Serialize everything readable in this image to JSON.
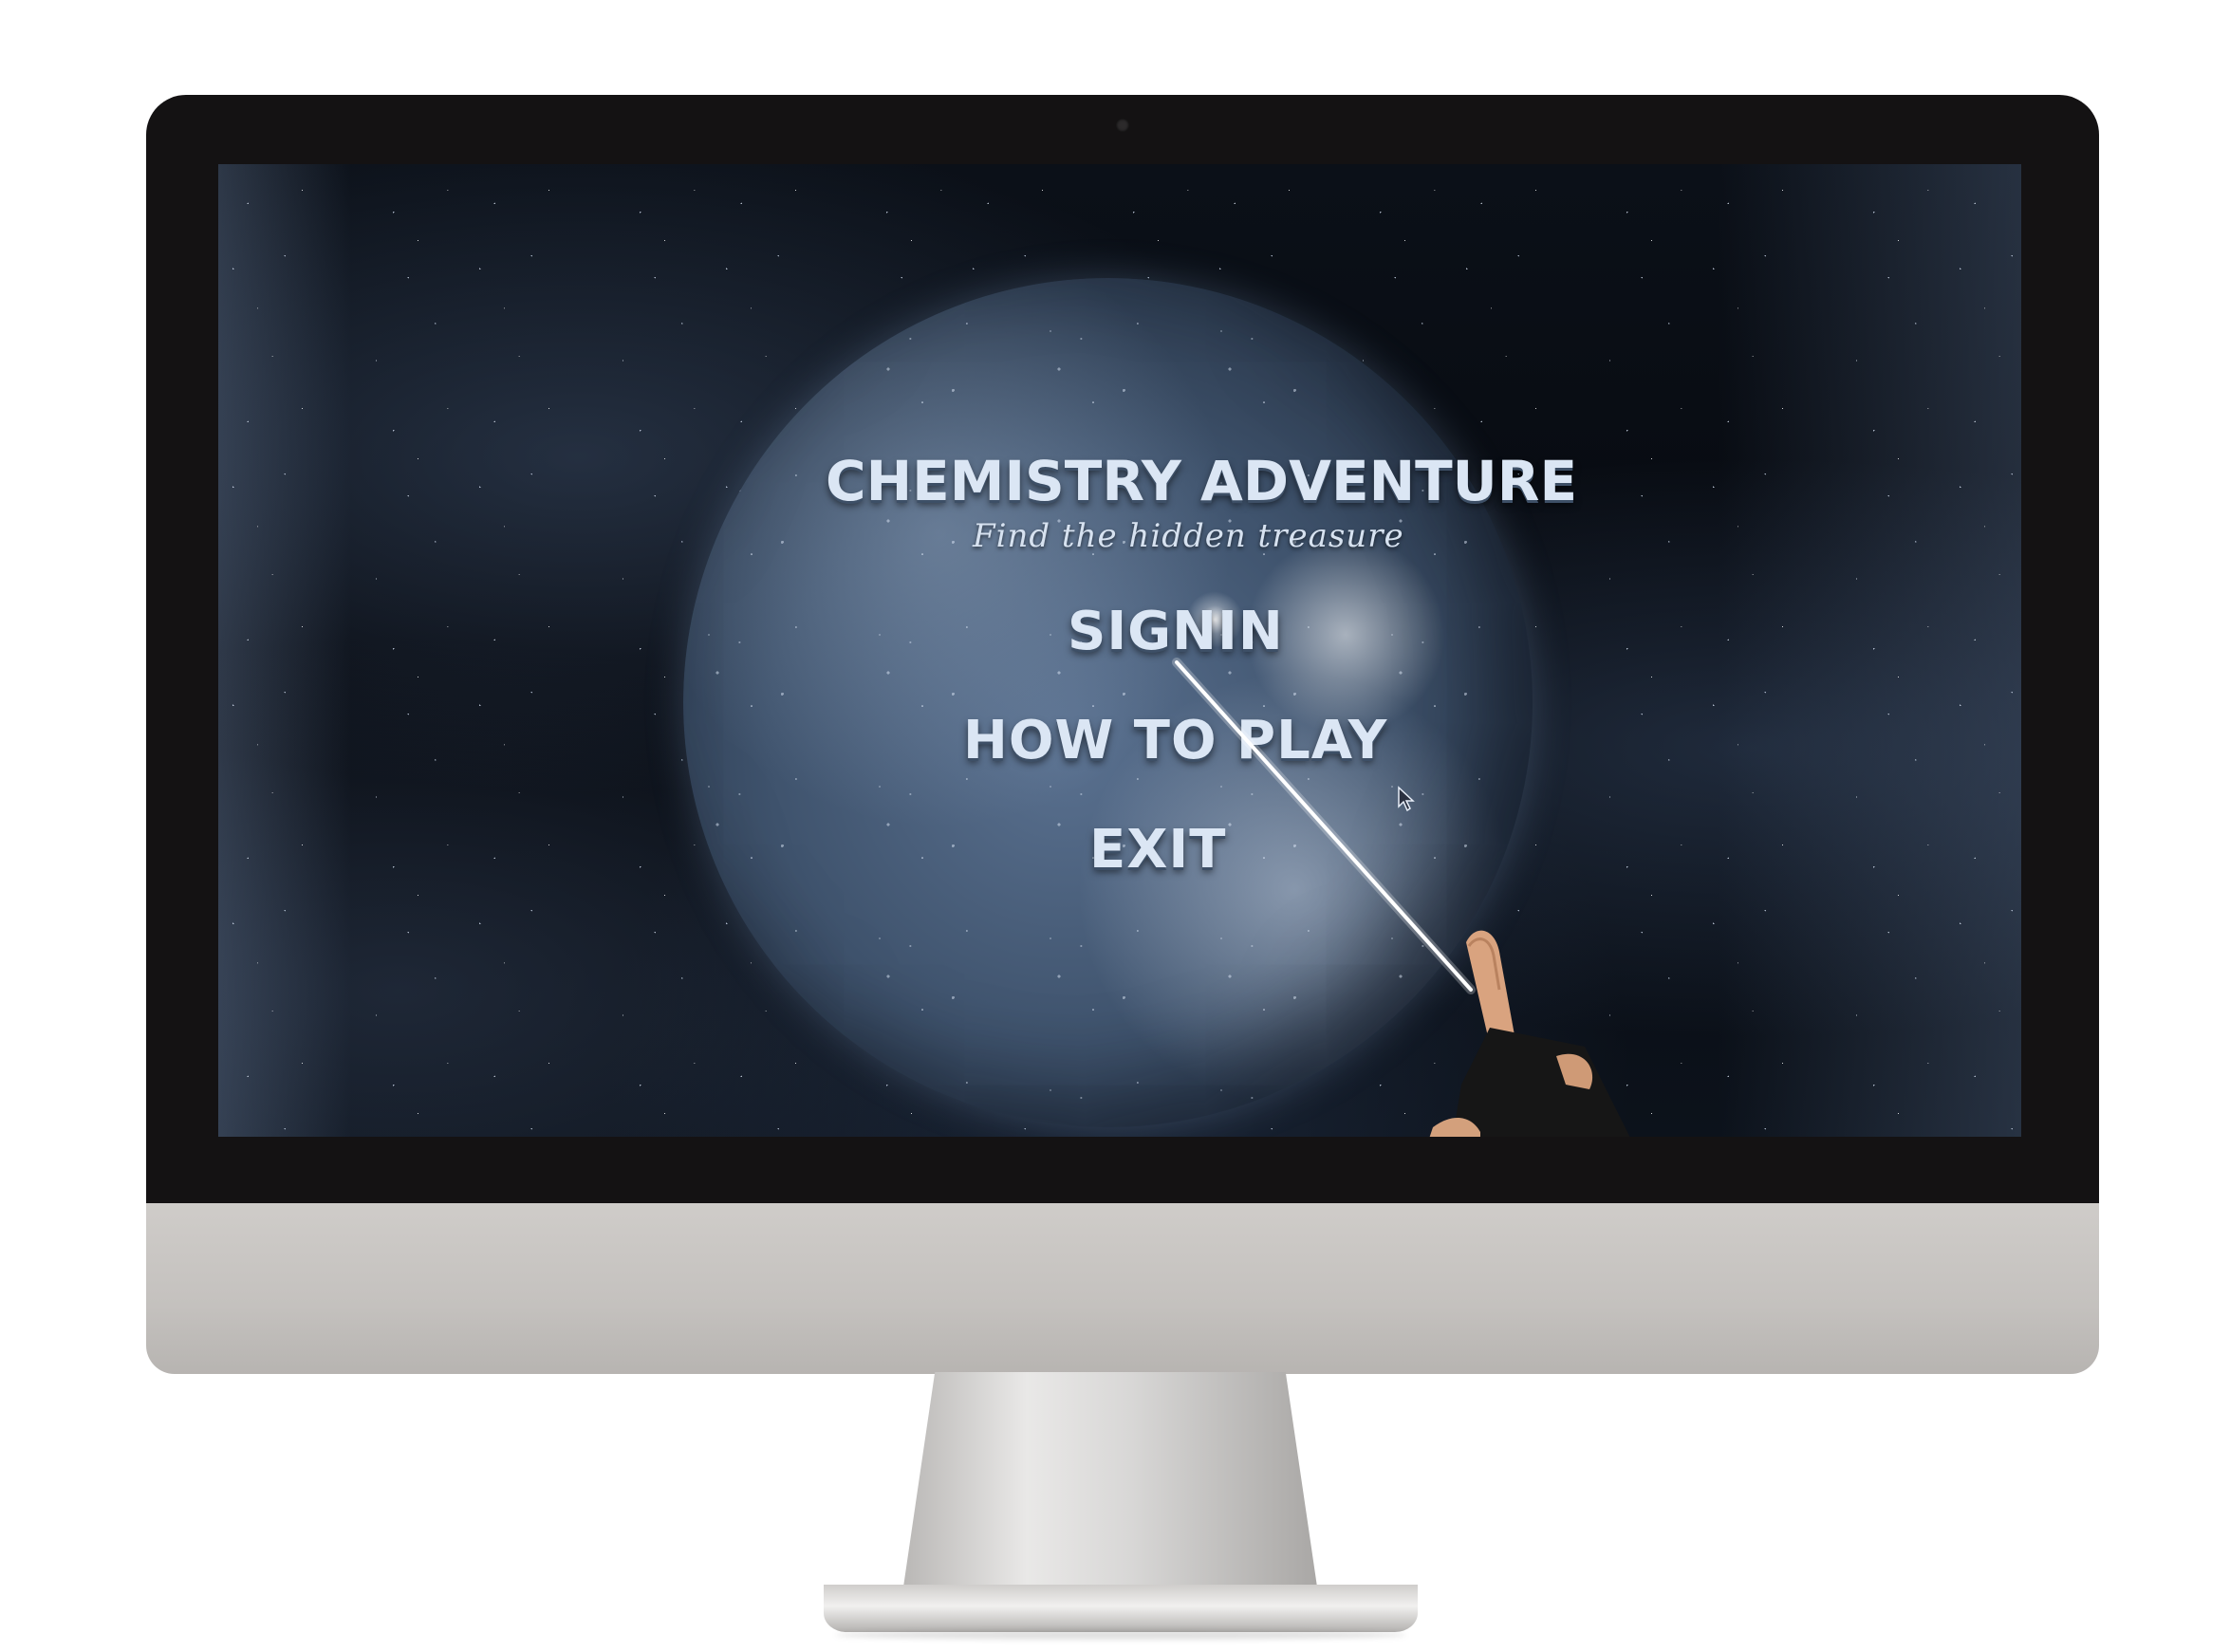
{
  "game": {
    "title": "CHEMISTRY ADVENTURE",
    "subtitle": "Find the hidden treasure",
    "menu": {
      "signin_label": "SIGNIN",
      "how_to_play_label": "HOW TO PLAY",
      "exit_label": "EXIT"
    }
  },
  "colors": {
    "bezel": "#141213",
    "chin": "#c4c1be",
    "menu_text": "#dbe6f4",
    "planet": "#4a5f7c",
    "space": "#070a10"
  },
  "icons": [
    "webcam-icon",
    "cursor-icon",
    "laser-pointer",
    "vr-hand-controller"
  ]
}
